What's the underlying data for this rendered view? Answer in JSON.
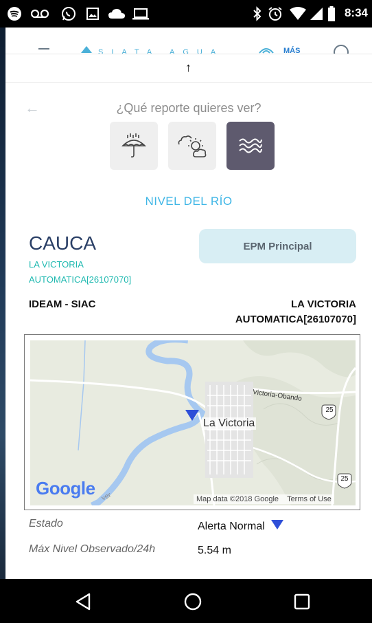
{
  "status_bar": {
    "time": "8:34",
    "icons": [
      "spotify-icon",
      "voicemail-icon",
      "whatsapp-icon",
      "gallery-icon",
      "cloud-icon",
      "laptop-icon",
      "bluetooth-icon",
      "alarm-icon",
      "wifi-icon",
      "signal-icon",
      "battery-icon"
    ]
  },
  "app_bar": {
    "brand": "SIATA AGUA",
    "mas_label": "MÁS"
  },
  "screen": {
    "question": "¿Qué reporte quieres ver?",
    "report_types": [
      {
        "icon": "rain-umbrella-icon",
        "active": false
      },
      {
        "icon": "weather-sun-cloud-icon",
        "active": false
      },
      {
        "icon": "river-waves-icon",
        "active": true
      }
    ],
    "section_title": "NIVEL DEL RÍO"
  },
  "station": {
    "river": "CAUCA",
    "line1": "LA VICTORIA",
    "line2": "AUTOMATICA[26107070]",
    "epm_button": "EPM Principal",
    "source": "IDEAM - SIAC",
    "right_line1": "LA VICTORIA",
    "right_line2": "AUTOMATICA[26107070]"
  },
  "map": {
    "town_label": "La Victoria",
    "road_label": "Victoria-Obando",
    "shield_25": "25",
    "river_label": "ver",
    "google_logo": "Google",
    "attribution": "Map data ©2018 Google",
    "terms": "Terms of Use",
    "accent": "#2f4fd8"
  },
  "details": {
    "estado_label": "Estado",
    "estado_value": "Alerta Normal",
    "max_label": "Máx Nivel Observado/24h",
    "max_value": "5.54 m"
  },
  "colors": {
    "teal": "#1fb9b0",
    "blue_title": "#3fb6e6",
    "navy": "#2a3f66",
    "epm_bg": "#d8eef4"
  }
}
